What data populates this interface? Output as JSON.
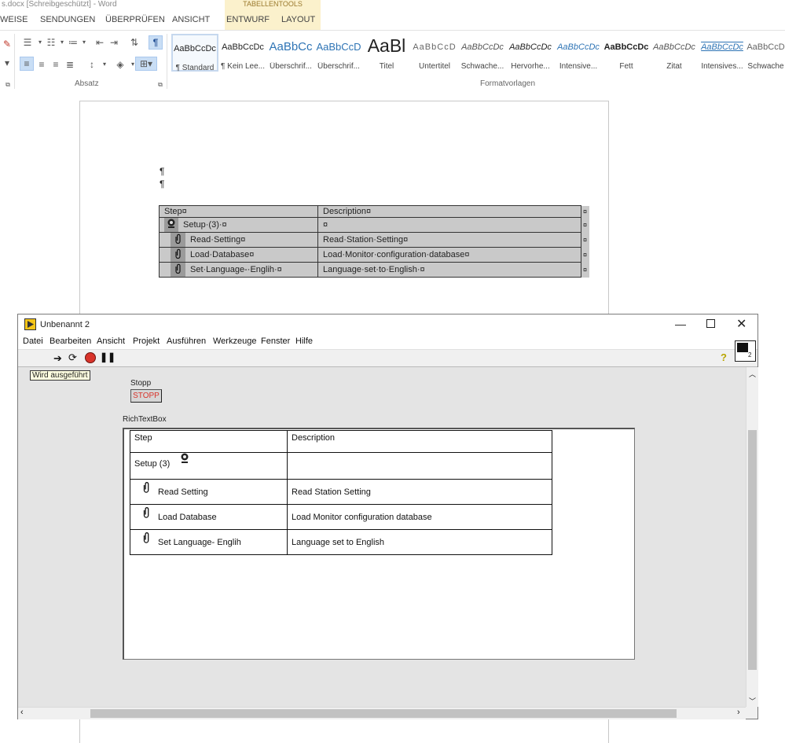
{
  "word": {
    "title": "s.docx [Schreibgeschützt] - Word",
    "contextual_tab": "TABELLENTOOLS",
    "tabs": [
      "WEISE",
      "SENDUNGEN",
      "ÜBERPRÜFEN",
      "ANSICHT",
      "ENTWURF",
      "LAYOUT"
    ],
    "groups": {
      "paragraph": "Absatz",
      "styles": "Formatvorlagen"
    },
    "styles": [
      {
        "preview": "AaBbCcDc",
        "name": "¶ Standard"
      },
      {
        "preview": "AaBbCcDc",
        "name": "¶ Kein Lee..."
      },
      {
        "preview": "AaBbCc",
        "name": "Überschrif..."
      },
      {
        "preview": "AaBbCcD",
        "name": "Überschrif..."
      },
      {
        "preview": "AaBl",
        "name": "Titel"
      },
      {
        "preview": "AaBbCcD",
        "name": "Untertitel"
      },
      {
        "preview": "AaBbCcDc",
        "name": "Schwache..."
      },
      {
        "preview": "AaBbCcDc",
        "name": "Hervorhe..."
      },
      {
        "preview": "AaBbCcDc",
        "name": "Intensive..."
      },
      {
        "preview": "AaBbCcDc",
        "name": "Fett"
      },
      {
        "preview": "AaBbCcDc",
        "name": "Zitat"
      },
      {
        "preview": "AaBbCcDc",
        "name": "Intensives..."
      },
      {
        "preview": "AaBbCcD",
        "name": "Schwache"
      }
    ],
    "pilcrows": [
      "¶",
      "¶"
    ],
    "table": {
      "header": [
        "Step¤",
        "Description¤"
      ],
      "rows": [
        [
          "Setup·(3)·¤",
          "¤"
        ],
        [
          "Read·Setting¤",
          "Read·Station·Setting¤"
        ],
        [
          "Load·Database¤",
          "Load·Monitor·configuration·database¤"
        ],
        [
          "Set·Language-·Englih·¤",
          "Language·set·to·English·¤"
        ]
      ],
      "end_mark": "¤"
    }
  },
  "labview": {
    "title": "Unbenannt 2",
    "menu": [
      "Datei",
      "Bearbeiten",
      "Ansicht",
      "Projekt",
      "Ausführen",
      "Werkzeuge",
      "Fenster",
      "Hilfe"
    ],
    "running_label": "Wird ausgeführt",
    "stop_label": "Stopp",
    "stop_button": "STOPP",
    "richtext_label": "RichTextBox",
    "vi_icon_number": "2",
    "help_icon": "?",
    "table": {
      "header": [
        "Step",
        "Description"
      ],
      "rows": [
        [
          "Setup (3)",
          ""
        ],
        [
          "Read Setting",
          "Read Station Setting"
        ],
        [
          "Load Database",
          "Load Monitor configuration database"
        ],
        [
          "Set Language- Englih",
          "Language set to English"
        ]
      ]
    },
    "icons": [
      "run-arrow-icon",
      "run-continuously-icon",
      "abort-icon",
      "pause-icon",
      "context-help-icon",
      "vi-icon",
      "webcam-icon",
      "paperclip-icon"
    ]
  },
  "colors": {
    "word_accent": "#2b579a",
    "contextual_band": "#fbf1cc",
    "table_shading": "#c9c9c9",
    "stop_red": "#d9342b"
  }
}
